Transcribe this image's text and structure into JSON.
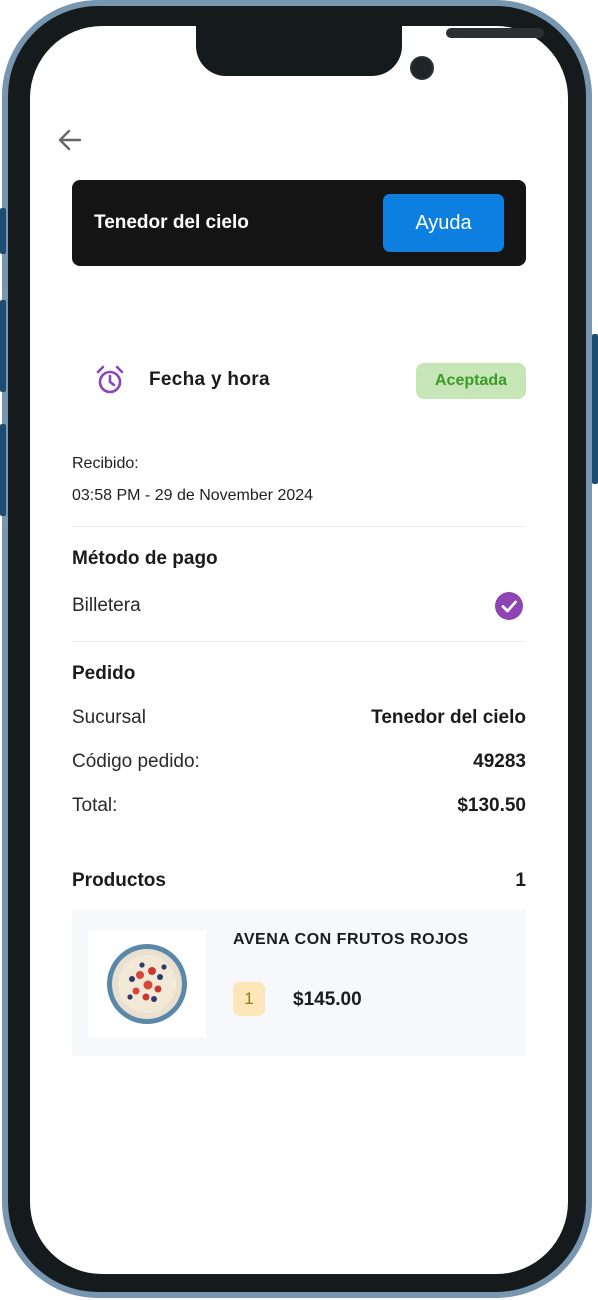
{
  "header": {
    "title": "Tenedor del cielo",
    "help_label": "Ayuda"
  },
  "status": {
    "label": "Fecha y hora",
    "badge": "Aceptada"
  },
  "received": {
    "label": "Recibido:",
    "value": "03:58 PM - 29 de November 2024"
  },
  "payment": {
    "title": "Método de pago",
    "method": "Billetera"
  },
  "order": {
    "title": "Pedido",
    "rows": [
      {
        "label": "Sucursal",
        "value": "Tenedor del cielo"
      },
      {
        "label": "Código pedido:",
        "value": "49283"
      },
      {
        "label": "Total:",
        "value": "$130.50"
      }
    ]
  },
  "products": {
    "title": "Productos",
    "count": "1",
    "items": [
      {
        "name": "AVENA CON FRUTOS ROJOS",
        "quantity": "1",
        "price": "$145.00"
      }
    ]
  },
  "icons": {
    "back": "arrow-left-icon",
    "alarm": "alarm-clock-icon",
    "check": "check-circle-icon"
  },
  "colors": {
    "accent": "#0d7fe0",
    "status_bg": "#c6e6b8",
    "status_text": "#3c9a24",
    "purple": "#8e44b5"
  }
}
